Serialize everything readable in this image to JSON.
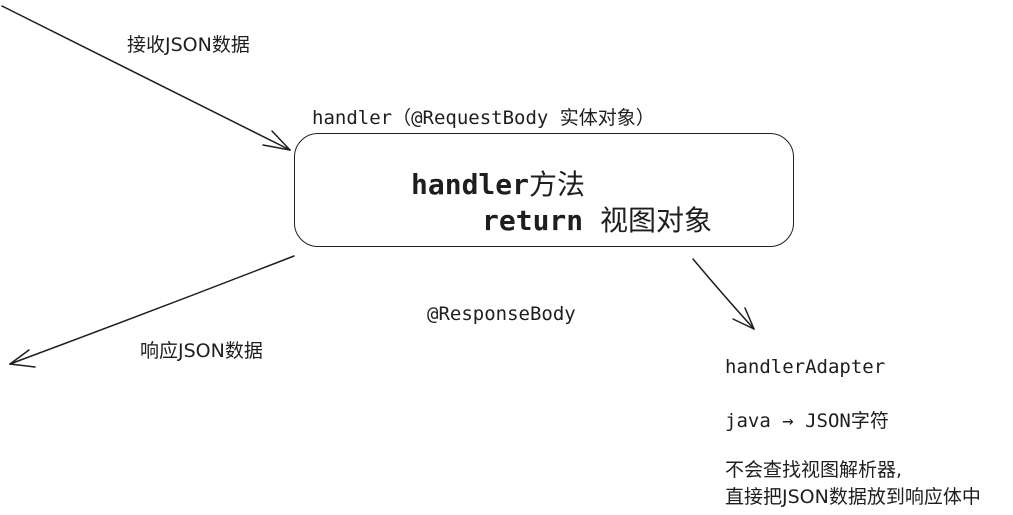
{
  "edges": {
    "receive_label": "接收JSON数据",
    "respond_label": "响应JSON数据"
  },
  "handler_box": {
    "top_label": "handler（@RequestBody 实体对象）",
    "line1": "handler方法",
    "line2": "return 视图对象"
  },
  "response_body_label": "@ResponseBody",
  "adapter": {
    "title": "handlerAdapter",
    "conversion": "java → JSON字符",
    "note_line1": "不会查找视图解析器,",
    "note_line2": "直接把JSON数据放到响应体中"
  },
  "colors": {
    "stroke": "#1e1e1e",
    "background": "#ffffff"
  }
}
